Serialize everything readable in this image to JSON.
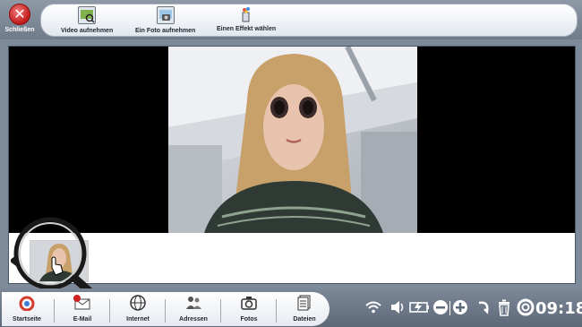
{
  "top": {
    "close_label": "Schließen",
    "tools": [
      {
        "label": "Video aufnehmen",
        "icon": "video-camera-icon"
      },
      {
        "label": "Ein Foto aufnehmen",
        "icon": "photo-camera-icon"
      },
      {
        "label": "Einen Effekt wählen",
        "icon": "magic-wand-icon"
      }
    ]
  },
  "dock": {
    "items": [
      {
        "label": "Startseite",
        "icon": "home-icon"
      },
      {
        "label": "E-Mail",
        "icon": "email-icon"
      },
      {
        "label": "Internet",
        "icon": "globe-icon"
      },
      {
        "label": "Adressen",
        "icon": "contacts-icon"
      },
      {
        "label": "Fotos",
        "icon": "camera-icon"
      },
      {
        "label": "Dateien",
        "icon": "files-icon"
      }
    ]
  },
  "status": {
    "time": "09:18",
    "icons": [
      "wifi-icon",
      "volume-icon",
      "battery-icon",
      "zoom-out-icon",
      "zoom-in-icon",
      "back-icon",
      "trash-icon",
      "help-icon"
    ]
  },
  "colors": {
    "accent": "#c21b1b",
    "bar": "#7d8a9a"
  }
}
